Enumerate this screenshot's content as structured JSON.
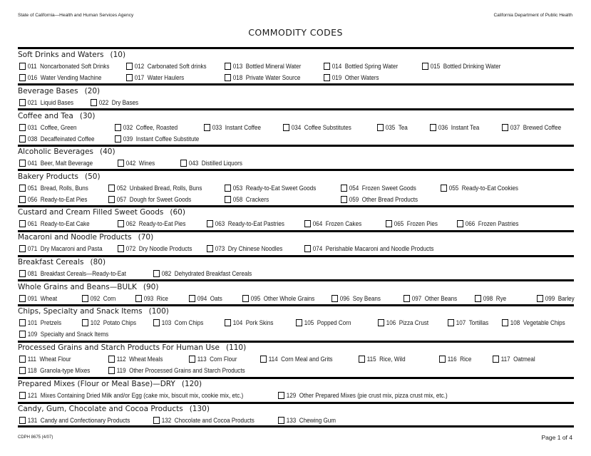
{
  "header": {
    "agency": "State of California—Health and Human Services Agency",
    "department": "California Department of Public Health",
    "title": "COMMODITY CODES"
  },
  "sections": [
    {
      "title": "Soft Drinks and Waters",
      "code": "(10)",
      "items": [
        {
          "num": "011",
          "label": "Noncarbonated Soft Drinks",
          "checked": false
        },
        {
          "num": "012",
          "label": "Carbonated Soft drinks",
          "checked": false
        },
        {
          "num": "013",
          "label": "Bottled Mineral Water",
          "checked": false
        },
        {
          "num": "014",
          "label": "Bottled Spring Water",
          "checked": false
        },
        {
          "num": "015",
          "label": "Bottled Drinking Water",
          "checked": false
        },
        {
          "num": "016",
          "label": "Water Vending Machine",
          "checked": false
        },
        {
          "num": "017",
          "label": "Water Haulers",
          "checked": false
        },
        {
          "num": "018",
          "label": "Private Water Source",
          "checked": false
        },
        {
          "num": "019",
          "label": "Other Waters",
          "checked": false
        }
      ]
    },
    {
      "title": "Beverage Bases",
      "code": "(20)",
      "items": [
        {
          "num": "021",
          "label": "Liquid Bases",
          "checked": false
        },
        {
          "num": "022",
          "label": "Dry Bases",
          "checked": false
        }
      ]
    },
    {
      "title": "Coffee and Tea",
      "code": "(30)",
      "items": [
        {
          "num": "031",
          "label": "Coffee, Green",
          "checked": false
        },
        {
          "num": "032",
          "label": "Coffee, Roasted",
          "checked": false
        },
        {
          "num": "033",
          "label": "Instant Coffee",
          "checked": false
        },
        {
          "num": "034",
          "label": "Coffee Substitutes",
          "checked": false
        },
        {
          "num": "035",
          "label": "Tea",
          "checked": false
        },
        {
          "num": "036",
          "label": "Instant Tea",
          "checked": false
        },
        {
          "num": "037",
          "label": "Brewed Coffee",
          "checked": false
        },
        {
          "num": "038",
          "label": "Decaffeinated Coffee",
          "checked": false
        },
        {
          "num": "039",
          "label": "Instant Coffee Substitute",
          "checked": false
        }
      ]
    },
    {
      "title": "Alcoholic Beverages",
      "code": "(40)",
      "items": [
        {
          "num": "041",
          "label": "Beer, Malt Beverage",
          "checked": false
        },
        {
          "num": "042",
          "label": "Wines",
          "checked": false
        },
        {
          "num": "043",
          "label": "Distilled Liquors",
          "checked": false
        }
      ]
    },
    {
      "title": "Bakery Products",
      "code": "(50)",
      "items": [
        {
          "num": "051",
          "label": "Bread, Rolls, Buns",
          "checked": false
        },
        {
          "num": "052",
          "label": "Unbaked Bread, Rolls, Buns",
          "checked": false
        },
        {
          "num": "053",
          "label": "Ready-to-Eat Sweet Goods",
          "checked": false
        },
        {
          "num": "054",
          "label": "Frozen Sweet Goods",
          "checked": false
        },
        {
          "num": "055",
          "label": "Ready-to-Eat Cookies",
          "checked": false
        },
        {
          "num": "056",
          "label": "Ready-to-Eat Pies",
          "checked": false
        },
        {
          "num": "057",
          "label": "Dough for Sweet Goods",
          "checked": false
        },
        {
          "num": "058",
          "label": "Crackers",
          "checked": false
        },
        {
          "num": "059",
          "label": "Other Bread Products",
          "checked": false
        }
      ]
    },
    {
      "title": "Custard and Cream Filled Sweet Goods",
      "code": "(60)",
      "items": [
        {
          "num": "061",
          "label": "Ready-to-Eat Cake",
          "checked": false
        },
        {
          "num": "062",
          "label": "Ready-to-Eat Pies",
          "checked": false
        },
        {
          "num": "063",
          "label": "Ready-to-Eat Pastries",
          "checked": false
        },
        {
          "num": "064",
          "label": "Frozen Cakes",
          "checked": false
        },
        {
          "num": "065",
          "label": "Frozen Pies",
          "checked": false
        },
        {
          "num": "066",
          "label": "Frozen Pastries",
          "checked": false
        }
      ]
    },
    {
      "title": "Macaroni and Noodle Products",
      "code": "(70)",
      "items": [
        {
          "num": "071",
          "label": "Dry Macaroni and Pasta",
          "checked": false
        },
        {
          "num": "072",
          "label": "Dry Noodle Products",
          "checked": false
        },
        {
          "num": "073",
          "label": "Dry Chinese Noodles",
          "checked": false
        },
        {
          "num": "074",
          "label": "Perishable Macaroni and Noodle Products",
          "checked": false
        }
      ]
    },
    {
      "title": "Breakfast Cereals",
      "code": "(80)",
      "items": [
        {
          "num": "081",
          "label": "Breakfast Cereals—Ready-to-Eat",
          "checked": false
        },
        {
          "num": "082",
          "label": "Dehydrated Breakfast Cereals",
          "checked": false
        }
      ]
    },
    {
      "title": "Whole Grains and Beans—BULK",
      "code": "(90)",
      "items": [
        {
          "num": "091",
          "label": "Wheat",
          "checked": false
        },
        {
          "num": "092",
          "label": "Corn",
          "checked": false
        },
        {
          "num": "093",
          "label": "Rice",
          "checked": false
        },
        {
          "num": "094",
          "label": "Oats",
          "checked": false
        },
        {
          "num": "095",
          "label": "Other Whole Grains",
          "checked": false
        },
        {
          "num": "096",
          "label": "Soy Beans",
          "checked": false
        },
        {
          "num": "097",
          "label": "Other Beans",
          "checked": false
        },
        {
          "num": "098",
          "label": "Rye",
          "checked": false
        },
        {
          "num": "099",
          "label": "Barley",
          "checked": false
        }
      ]
    },
    {
      "title": "Chips, Specialty and Snack Items",
      "code": "(100)",
      "items": [
        {
          "num": "101",
          "label": "Pretzels",
          "checked": false
        },
        {
          "num": "102",
          "label": "Potato Chips",
          "checked": false
        },
        {
          "num": "103",
          "label": "Corn Chips",
          "checked": false
        },
        {
          "num": "104",
          "label": "Pork Skins",
          "checked": false
        },
        {
          "num": "105",
          "label": "Popped Corn",
          "checked": false
        },
        {
          "num": "106",
          "label": "Pizza Crust",
          "checked": false
        },
        {
          "num": "107",
          "label": "Tortillas",
          "checked": false
        },
        {
          "num": "108",
          "label": "Vegetable Chips",
          "checked": false
        },
        {
          "num": "109",
          "label": "Specialty and Snack Items",
          "checked": false
        }
      ]
    },
    {
      "title": "Processed Grains and Starch Products For Human Use",
      "code": "(110)",
      "items": [
        {
          "num": "111",
          "label": "Wheat Flour",
          "checked": false
        },
        {
          "num": "112",
          "label": "Wheat Meals",
          "checked": false
        },
        {
          "num": "113",
          "label": "Corn Flour",
          "checked": false
        },
        {
          "num": "114",
          "label": "Corn Meal and Grits",
          "checked": false
        },
        {
          "num": "115",
          "label": "Rice, Wild",
          "checked": false
        },
        {
          "num": "116",
          "label": "Rice",
          "checked": false
        },
        {
          "num": "117",
          "label": "Oatmeal",
          "checked": false
        },
        {
          "num": "118",
          "label": "Granola-type Mixes",
          "checked": false
        },
        {
          "num": "119",
          "label": "Other Processed Grains and Starch Products",
          "checked": false
        }
      ]
    },
    {
      "title": "Prepared Mixes (Flour or Meal Base)—DRY",
      "code": "(120)",
      "items": [
        {
          "num": "121",
          "label": "Mixes Containing Dried Milk and/or Egg (cake mix, biscuit mix, cookie mix, etc.)",
          "checked": false
        },
        {
          "num": "129",
          "label": "Other Prepared Mixes  (pie crust mix, pizza crust mix, etc.)",
          "checked": false
        }
      ]
    },
    {
      "title": "Candy, Gum, Chocolate and Cocoa Products",
      "code": "(130)",
      "items": [
        {
          "num": "131",
          "label": "Candy and Confectionary Products",
          "checked": false
        },
        {
          "num": "132",
          "label": "Chocolate and Cocoa Products",
          "checked": false
        },
        {
          "num": "133",
          "label": "Chewing Gum",
          "checked": false
        }
      ]
    }
  ],
  "footer": {
    "form_id": "CDPH 8675 (4/07)",
    "page": "Page 1 of 4"
  }
}
